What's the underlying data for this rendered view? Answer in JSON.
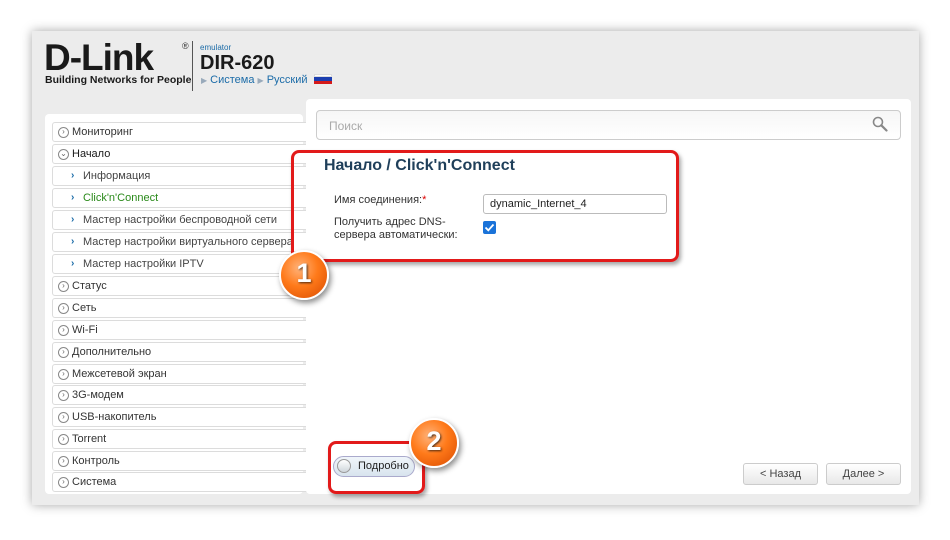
{
  "header": {
    "logo_text": "D-Link",
    "logo_reg": "®",
    "logo_tagline": "Building Networks for People",
    "emulator_label": "emulator",
    "model": "DIR-620",
    "nav_system": "Система",
    "nav_language": "Русский"
  },
  "sidebar": {
    "items": [
      {
        "label": "Мониторинг",
        "icon": "chevron-right-circle-icon"
      },
      {
        "label": "Начало",
        "icon": "chevron-down-circle-icon"
      },
      {
        "label": "Информация",
        "icon": "chevron-right-icon"
      },
      {
        "label": "Click'n'Connect",
        "icon": "chevron-right-icon"
      },
      {
        "label": "Мастер настройки беспроводной сети",
        "icon": "chevron-right-icon"
      },
      {
        "label": "Мастер настройки виртуального сервера",
        "icon": "chevron-right-icon"
      },
      {
        "label": "Мастер настройки IPTV",
        "icon": "chevron-right-icon"
      },
      {
        "label": "Статус",
        "icon": "chevron-right-circle-icon"
      },
      {
        "label": "Сеть",
        "icon": "chevron-right-circle-icon"
      },
      {
        "label": "Wi-Fi",
        "icon": "chevron-right-circle-icon"
      },
      {
        "label": "Дополнительно",
        "icon": "chevron-right-circle-icon"
      },
      {
        "label": "Межсетевой экран",
        "icon": "chevron-right-circle-icon"
      },
      {
        "label": "3G-модем",
        "icon": "chevron-right-circle-icon"
      },
      {
        "label": "USB-накопитель",
        "icon": "chevron-right-circle-icon"
      },
      {
        "label": "Torrent",
        "icon": "chevron-right-circle-icon"
      },
      {
        "label": "Контроль",
        "icon": "chevron-right-circle-icon"
      },
      {
        "label": "Система",
        "icon": "chevron-right-circle-icon"
      }
    ]
  },
  "main": {
    "search_placeholder": "Поиск",
    "page_title": "Начало /  Click'n'Connect",
    "connection_name_label": "Имя соединения:",
    "connection_name_required": "*",
    "connection_name_value": "dynamic_Internet_4",
    "dns_auto_label": "Получить адрес DNS-сервера автоматически:",
    "dns_auto_checked": true,
    "advanced_toggle_label": "Подробно",
    "back_button": "< Назад",
    "next_button": "Далее >"
  },
  "annotations": {
    "badge_1": "1",
    "badge_2": "2",
    "color": "#e21a1a"
  },
  "colors": {
    "active_menu": "#2a8a1a",
    "link_blue": "#1c6ca8",
    "title": "#1f3f5a"
  }
}
